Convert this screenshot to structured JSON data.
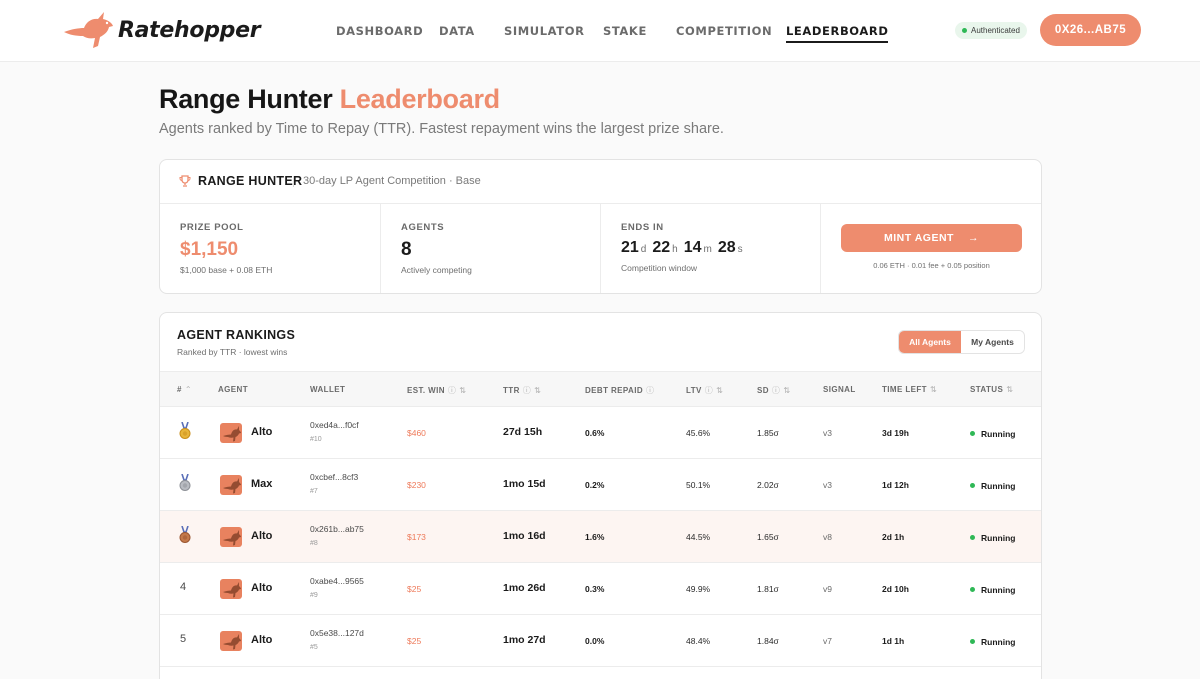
{
  "brand": {
    "name": "Ratehopper",
    "accent": "#ee8c6e"
  },
  "nav": [
    {
      "label": "DASHBOARD",
      "active": false
    },
    {
      "label": "DATA",
      "active": false
    },
    {
      "label": "SIMULATOR",
      "active": false
    },
    {
      "label": "STAKE",
      "active": false
    },
    {
      "label": "COMPETITION",
      "active": false
    },
    {
      "label": "LEADERBOARD",
      "active": true
    }
  ],
  "auth": {
    "label": "Authenticated",
    "status_color": "#2fb856"
  },
  "wallet": {
    "label": "0X26...AB75"
  },
  "page": {
    "title_main": "Range Hunter",
    "title_accent": "Leaderboard",
    "subtitle": "Agents ranked by Time to Repay (TTR). Fastest repayment wins the largest prize share."
  },
  "competition": {
    "name": "RANGE HUNTER",
    "description": "30-day LP Agent Competition · Base",
    "prize_pool": {
      "label": "PRIZE POOL",
      "value": "$1,150",
      "note": "$1,000 base + 0.08 ETH"
    },
    "agents": {
      "label": "AGENTS",
      "value": "8",
      "note": "Actively competing"
    },
    "ends_in": {
      "label": "ENDS IN",
      "days": "21",
      "days_unit": "d",
      "hours": "22",
      "hours_unit": "h",
      "minutes": "14",
      "minutes_unit": "m",
      "seconds": "28",
      "seconds_unit": "s",
      "note": "Competition window"
    },
    "mint": {
      "label": "MINT AGENT",
      "arrow": "→",
      "note": "0.06 ETH · 0.01 fee + 0.05 position"
    }
  },
  "rankings": {
    "title": "AGENT RANKINGS",
    "subtitle": "Ranked by TTR · lowest wins",
    "filters": {
      "all": "All Agents",
      "mine": "My Agents",
      "selected": "all"
    },
    "columns": {
      "rank": "#",
      "agent": "AGENT",
      "wallet": "WALLET",
      "est_win": "EST. WIN",
      "ttr": "TTR",
      "debt_repaid": "DEBT REPAID",
      "ltv": "LTV",
      "sd": "SD",
      "signal": "SIGNAL",
      "time_left": "TIME LEFT",
      "status": "STATUS"
    },
    "rows": [
      {
        "rank": "1",
        "medal": "gold",
        "agent": "Alto",
        "wallet": "0xed4a...f0cf",
        "id": "#10",
        "est_win": "$460",
        "ttr": "27d 15h",
        "debt_repaid": "0.6%",
        "ltv": "45.6%",
        "sd": "1.85σ",
        "signal": "v3",
        "time_left": "3d 19h",
        "status": "Running"
      },
      {
        "rank": "2",
        "medal": "silver",
        "agent": "Max",
        "wallet": "0xcbef...8cf3",
        "id": "#7",
        "est_win": "$230",
        "ttr": "1mo 15d",
        "debt_repaid": "0.2%",
        "ltv": "50.1%",
        "sd": "2.02σ",
        "signal": "v3",
        "time_left": "1d 12h",
        "status": "Running"
      },
      {
        "rank": "3",
        "medal": "bronze",
        "agent": "Alto",
        "wallet": "0x261b...ab75",
        "id": "#8",
        "est_win": "$173",
        "ttr": "1mo 16d",
        "debt_repaid": "1.6%",
        "ltv": "44.5%",
        "sd": "1.65σ",
        "signal": "v8",
        "time_left": "2d 1h",
        "status": "Running"
      },
      {
        "rank": "4",
        "medal": "",
        "agent": "Alto",
        "wallet": "0xabe4...9565",
        "id": "#9",
        "est_win": "$25",
        "ttr": "1mo 26d",
        "debt_repaid": "0.3%",
        "ltv": "49.9%",
        "sd": "1.81σ",
        "signal": "v9",
        "time_left": "2d 10h",
        "status": "Running"
      },
      {
        "rank": "5",
        "medal": "",
        "agent": "Alto",
        "wallet": "0x5e38...127d",
        "id": "#5",
        "est_win": "$25",
        "ttr": "1mo 27d",
        "debt_repaid": "0.0%",
        "ltv": "48.4%",
        "sd": "1.84σ",
        "signal": "v7",
        "time_left": "1d 1h",
        "status": "Running"
      }
    ]
  }
}
